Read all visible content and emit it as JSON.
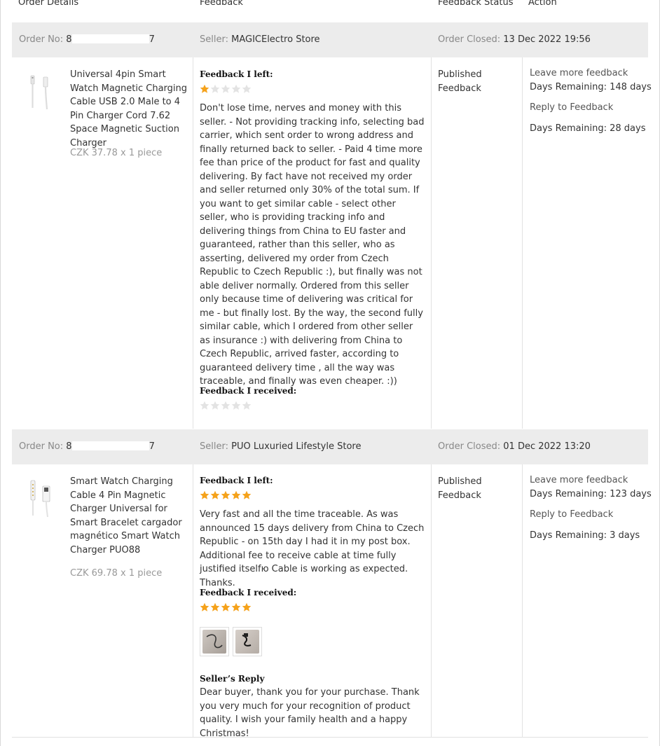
{
  "columns": {
    "order_details": "Order Details",
    "feedback": "Feedback",
    "feedback_status": "Feedback Status",
    "action": "Action"
  },
  "labels": {
    "order_no": "Order No:",
    "seller": "Seller:",
    "order_closed": "Order Closed:",
    "feedback_left": "Feedback I left:",
    "feedback_received": "Feedback I received:",
    "sellers_reply": "Seller’s Reply"
  },
  "orders": [
    {
      "order_no_start": "8",
      "order_no_end": "7",
      "seller": "MAGICElectro Store",
      "closed": "13 Dec 2022 19:56",
      "product_title": "Universal 4pin Smart Watch Magnetic Charging Cable USB 2.0 Male to 4 Pin Charger Cord 7.62 Space Magnetic Suction Charger",
      "price": "CZK 37.78 x 1 piece",
      "feedback_left_stars": 1,
      "feedback_left_text": "Don't lose time, nerves and money with this seller. - Not providing tracking info, selecting bad carrier, which sent order to wrong address and finally returned back to seller. - Paid 4 time more fee than price of the product for fast and quality delivering. By fact have not received my order and seller returned only 30% of the total sum. If you want to get similar cable - select other seller, who is providing tracking info and delivering things from China to EU faster and guaranteed, rather than this seller, who as asserting, delivered my order from Czech Republic to Czech Republic :), but finally was not able deliver normally. Ordered from this seller only because time of delivering was critical for me - but finally lost. By the way, the second fully similar cable, which I ordered from other seller as insurance :) with delivering from China to Czech Republic, arrived faster, according to guaranteed delivery time , all the way was traceable, and finally was even cheaper. :))",
      "feedback_received_stars": 0,
      "status": "Published Feedback",
      "leave_more": "Leave more feedback",
      "days_remaining_1": "Days Remaining: 148 days",
      "reply": "Reply to Feedback",
      "days_remaining_2": "Days Remaining: 28 days"
    },
    {
      "order_no_start": "8",
      "order_no_end": "7",
      "seller": "PUO Luxuried Lifestyle Store",
      "closed": "01 Dec 2022 13:20",
      "product_title": "Smart Watch Charging Cable 4 Pin Magnetic Charger Universal for Smart Bracelet cargador magnético Smart Watch Charger PUO88",
      "price": "CZK 69.78 x 1 piece",
      "feedback_left_stars": 5,
      "feedback_left_text": "Very fast and all the time traceable. As was announced 15 days delivery from China to Czech Republic - on 15th day I had it in my post box. Additional fee to receive cable at time fully justified itselfю Cable is working as expected. Thanks.",
      "feedback_received_stars": 5,
      "seller_reply": "Dear buyer, thank you for your purchase. Thank you very much for your recognition of product quality. I wish your family health and a happy Christmas!",
      "status": "Published Feedback",
      "leave_more": "Leave more feedback",
      "days_remaining_1": "Days Remaining: 123 days",
      "reply": "Reply to Feedback",
      "days_remaining_2": "Days Remaining: 3 days"
    }
  ],
  "colors": {
    "star_filled": "#f5a21b",
    "star_empty": "#e3e3e3",
    "bar_bg": "#ececec"
  }
}
